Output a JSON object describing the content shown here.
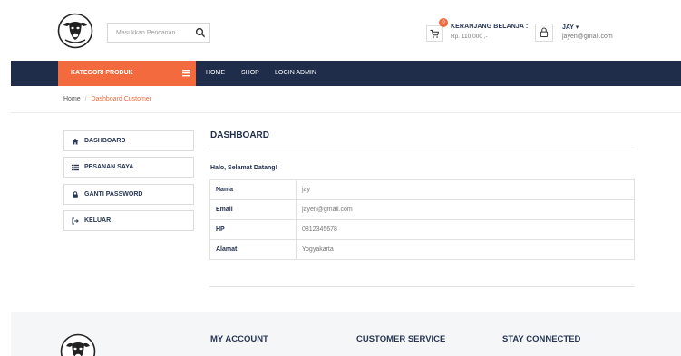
{
  "header": {
    "search": {
      "placeholder": "Masukkan Pencarian ..",
      "value": ""
    },
    "cart": {
      "badge": "0",
      "title": "KERANJANG BELANJA :",
      "total": "Rp. 110,000 ,-"
    },
    "user": {
      "name": "JAY ▾",
      "email": "jayen@gmail.com"
    }
  },
  "nav": {
    "category_label": "KATEGORI PRODUK",
    "links": [
      "HOME",
      "SHOP",
      "LOGIN ADMIN"
    ]
  },
  "breadcrumb": {
    "home": "Home",
    "separator": "/",
    "current": "Dashboard Customer"
  },
  "sidebar": {
    "items": [
      {
        "label": "DASHBOARD",
        "icon": "home-icon"
      },
      {
        "label": "PESANAN SAYA",
        "icon": "list-icon"
      },
      {
        "label": "GANTI PASSWORD",
        "icon": "lock-icon"
      },
      {
        "label": "KELUAR",
        "icon": "sign-out-icon"
      }
    ]
  },
  "main": {
    "title": "DASHBOARD",
    "greeting": "Halo, Selamat Datang!",
    "rows": [
      {
        "key": "Nama",
        "value": "jay"
      },
      {
        "key": "Email",
        "value": "jayen@gmail.com"
      },
      {
        "key": "HP",
        "value": "0812345678"
      },
      {
        "key": "Alamat",
        "value": "Yogyakarta"
      }
    ]
  },
  "footer": {
    "headings": [
      "MY ACCOUNT",
      "CUSTOMER SERVICE",
      "STAY CONNECTED"
    ]
  },
  "colors": {
    "navy": "#1f2d4a",
    "accent": "#f26a3d"
  }
}
